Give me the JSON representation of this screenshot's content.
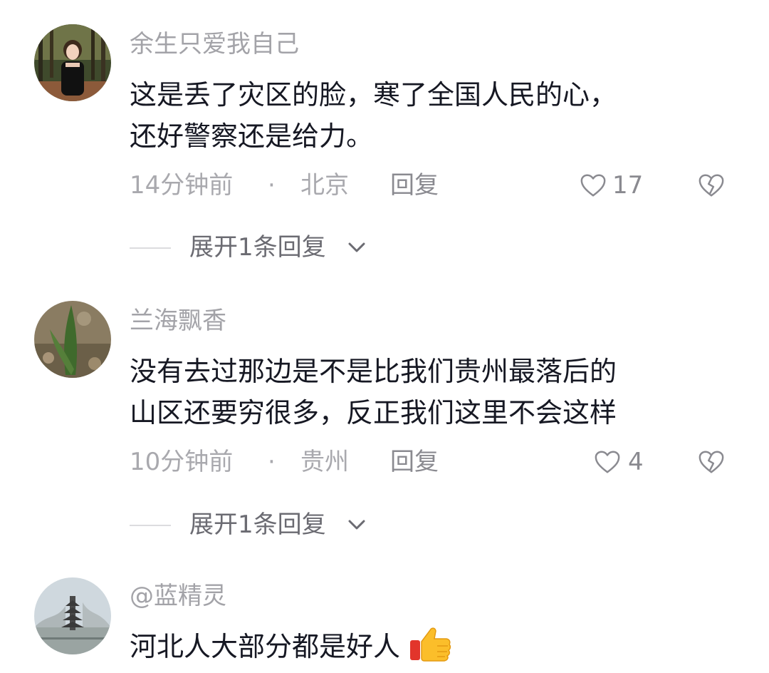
{
  "comments": [
    {
      "username": "余生只爱我自己",
      "content_lines": [
        "这是丢了灾区的脸，寒了全国人民的心，",
        "还好警察还是给力。"
      ],
      "time": "14分钟前",
      "separator": "·",
      "location": "北京",
      "reply_label": "回复",
      "likes": "17",
      "expand_label": "展开1条回复",
      "avatar_icon": "avatar-girl-in-forest"
    },
    {
      "username": "兰海飘香",
      "content_lines": [
        "没有去过那边是不是比我们贵州最落后的",
        "山区还要穷很多，反正我们这里不会这样"
      ],
      "time": "10分钟前",
      "separator": "·",
      "location": "贵州",
      "reply_label": "回复",
      "likes": "4",
      "expand_label": "展开1条回复",
      "avatar_icon": "avatar-plant-leaf"
    },
    {
      "username": "@蓝精灵",
      "content_lines": [
        "河北人大部分都是好人"
      ],
      "content_emoji": "thumbs-up-emoji",
      "avatar_icon": "avatar-pagoda-winter"
    }
  ],
  "colors": {
    "username": "#a3a3a8",
    "content": "#161823",
    "meta": "#a9a9ae",
    "expand": "#6b6b72",
    "background": "#ffffff"
  }
}
